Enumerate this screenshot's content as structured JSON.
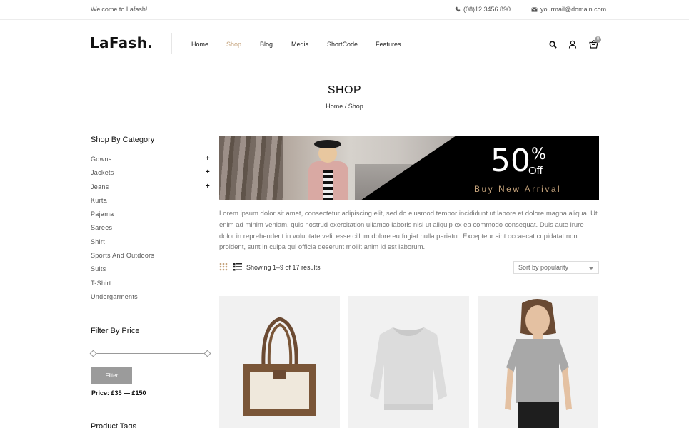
{
  "topbar": {
    "welcome": "Welcome to Lafash!",
    "phone": "(08)12 3456 890",
    "email": "yourmail@domain.com"
  },
  "header": {
    "logo": "LaFash.",
    "nav": [
      "Home",
      "Shop",
      "Blog",
      "Media",
      "ShortCode",
      "Features"
    ],
    "active_nav": "Shop",
    "cart_count": "0",
    "icons": [
      "search-icon",
      "user-icon",
      "cart-icon"
    ]
  },
  "page": {
    "title": "SHOP",
    "breadcrumb": "Home / Shop"
  },
  "sidebar": {
    "category_heading": "Shop By Category",
    "categories": [
      {
        "label": "Gowns",
        "expandable": true
      },
      {
        "label": "Jackets",
        "expandable": true
      },
      {
        "label": "Jeans",
        "expandable": true
      },
      {
        "label": "Kurta",
        "expandable": false
      },
      {
        "label": "Pajama",
        "expandable": false
      },
      {
        "label": "Sarees",
        "expandable": false
      },
      {
        "label": "Shirt",
        "expandable": false
      },
      {
        "label": "Sports And Outdoors",
        "expandable": false
      },
      {
        "label": "Suits",
        "expandable": false
      },
      {
        "label": "T-Shirt",
        "expandable": false
      },
      {
        "label": "Undergarments",
        "expandable": false
      }
    ],
    "price_heading": "Filter By Price",
    "filter_button": "Filter",
    "price_label": "Price: £35 — £150",
    "tags_heading": "Product Tags"
  },
  "banner": {
    "discount": "50",
    "percent": "%",
    "off": "Off",
    "subtitle": "Buy New Arrival"
  },
  "description": "Lorem ipsum dolor sit amet, consectetur adipiscing elit, sed do eiusmod tempor incididunt ut labore et dolore magna aliqua. Ut enim ad minim veniam, quis nostrud exercitation ullamco laboris nisi ut aliquip ex ea commodo consequat. Duis aute irure dolor in reprehenderit in voluptate velit esse cillum dolore eu fugiat nulla pariatur. Excepteur sint occaecat cupidatat non proident, sunt in culpa qui officia deserunt mollit anim id est laborum.",
  "toolbar": {
    "results": "Showing 1–9 of 17 results",
    "sort": "Sort by popularity",
    "view_icons": [
      "grid-icon",
      "list-icon"
    ]
  },
  "colors": {
    "accent": "#c4a27a",
    "button": "#9b9b9b"
  }
}
